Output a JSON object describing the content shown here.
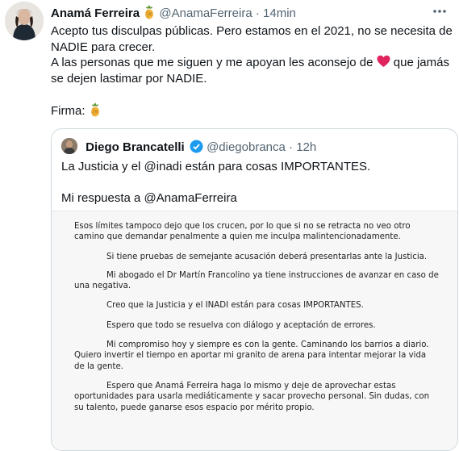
{
  "tweet": {
    "author_name": "Anamá Ferreira",
    "author_emoji": "pineapple",
    "handle": "@AnamaFerreira",
    "separator": "·",
    "time": "14min",
    "lines": {
      "l1": "Acepto tus disculpas públicas. Pero estamos en el 2021, no se necesita de NADIE para crecer.",
      "l2a": "A las personas que me siguen y me apoyan les aconsejo de",
      "l2b": "que jamás se dejen lastimar por NADIE.",
      "firma": "Firma:"
    }
  },
  "quote": {
    "author_name": "Diego Brancatelli",
    "handle": "@diegobranca",
    "separator": "·",
    "time": "12h",
    "text1": "La Justicia y el @inadi están para cosas IMPORTANTES.",
    "text2": "Mi respuesta a @AnamaFerreira",
    "doc": {
      "p1": "Esos límites tampoco dejo que los crucen, por lo que si no se retracta no veo otro camino que demandar penalmente a quien me inculpa malintencionadamente.",
      "p2": "Si tiene pruebas de semejante acusación deberá presentarlas ante la Justicia.",
      "p3": "Mi abogado el Dr Martín Francolino ya tiene instrucciones de avanzar en caso de una negativa.",
      "p4": "Creo que la Justicia y el INADI están para cosas IMPORTANTES.",
      "p5": "Espero que todo se resuelva con diálogo y aceptación de errores.",
      "p6": "Mi compromiso hoy y siempre es con la gente. Caminando los barrios a diario. Quiero invertir el tiempo en aportar mi granito de arena para intentar mejorar la vida de la gente.",
      "p7": "Espero que Anamá Ferreira  haga lo mismo y deje de aprovechar estas oportunidades para usarla mediáticamente y sacar provecho personal. Sin dudas, con su talento, puede ganarse esos espacio por mérito propio."
    }
  },
  "colors": {
    "text": "#0f1419",
    "muted": "#536471",
    "border": "#cfd9de",
    "heart": "#e0245e",
    "verified": "#1d9bf0"
  }
}
